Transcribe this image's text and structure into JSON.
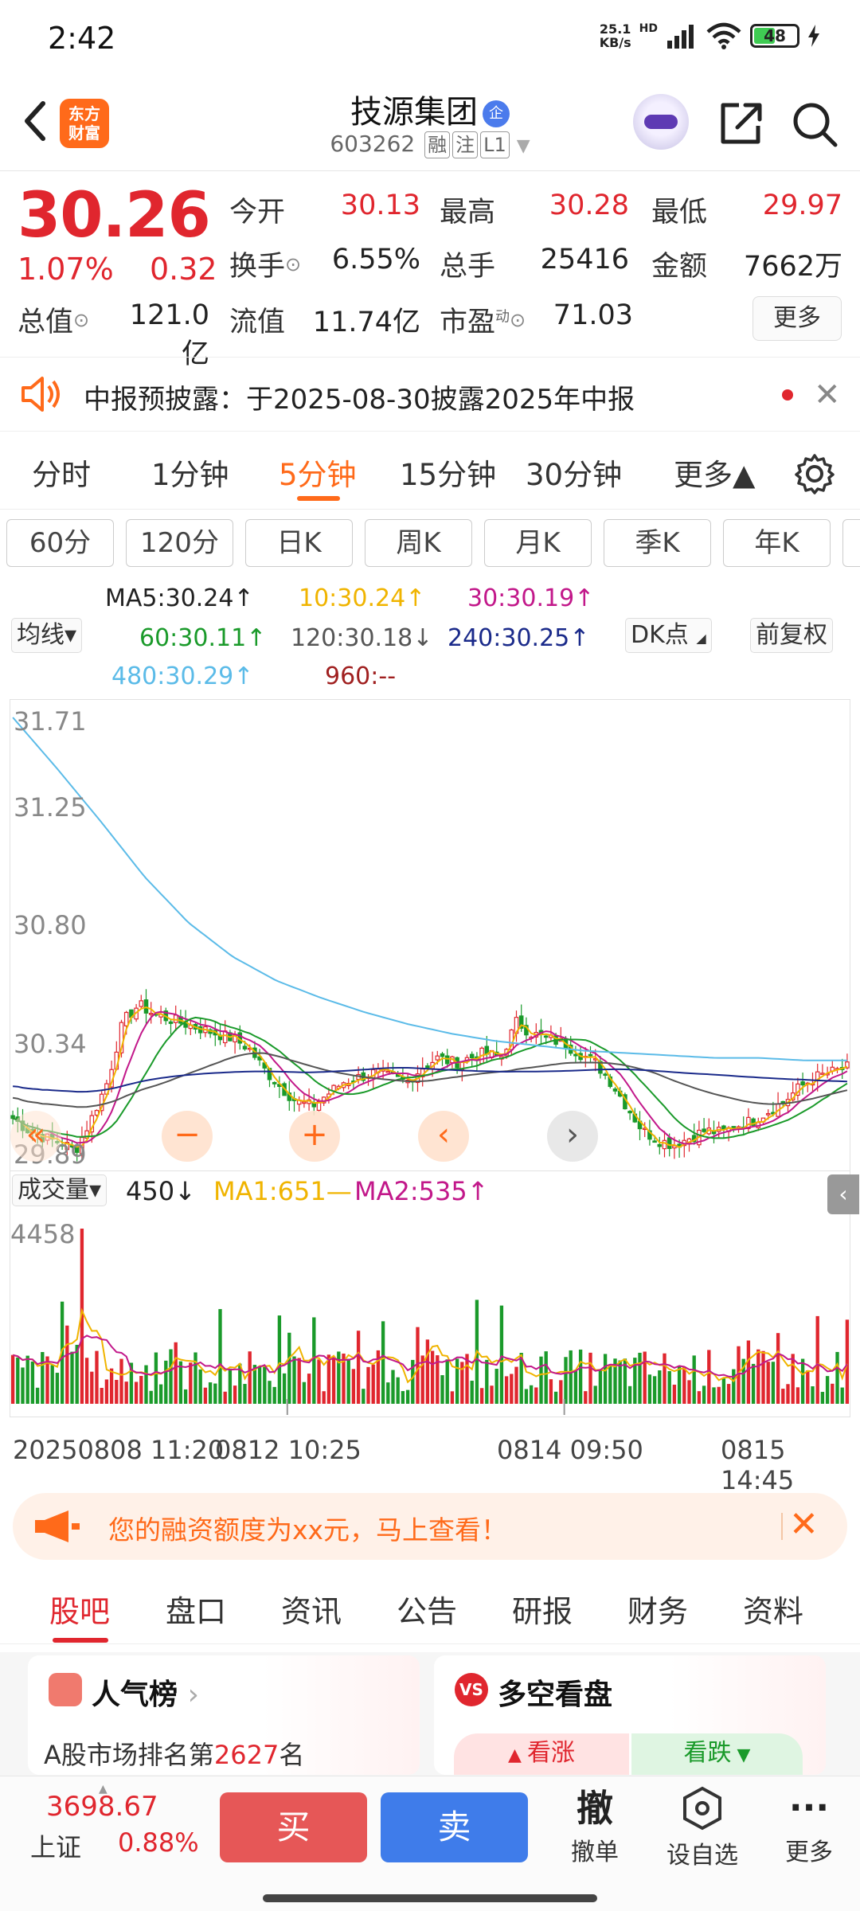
{
  "status_bar": {
    "time": "2:42",
    "net_speed_top": "25.1",
    "net_speed_bottom": "KB/s",
    "hd": "HD",
    "battery": "48"
  },
  "header": {
    "logo_line1": "东方",
    "logo_line2": "财富",
    "stock_name": "技源集团",
    "name_badge": "企",
    "stock_code": "603262",
    "tags": [
      "融",
      "注",
      "L1"
    ]
  },
  "quote": {
    "price": "30.26",
    "change_pct": "1.07%",
    "change": "0.32",
    "open_label": "今开",
    "open": "30.13",
    "high_label": "最高",
    "high": "30.28",
    "low_label": "最低",
    "low": "29.97",
    "turnover_label": "换手",
    "turnover": "6.55%",
    "volume_label": "总手",
    "volume": "25416",
    "amount_label": "金额",
    "amount": "7662万",
    "mktcap_label": "总值",
    "mktcap": "121.0亿",
    "float_label": "流值",
    "float_cap": "11.74亿",
    "pe_label": "市盈",
    "pe_sup": "动",
    "pe": "71.03",
    "more": "更多"
  },
  "notice": {
    "text": "中报预披露：于2025-08-30披露2025年中报"
  },
  "period_tabs": [
    "分时",
    "1分钟",
    "5分钟",
    "15分钟",
    "30分钟",
    "更多▲"
  ],
  "active_period": "5分钟",
  "kline_tabs": [
    "60分",
    "120分",
    "日K",
    "周K",
    "月K",
    "季K",
    "年K"
  ],
  "ma": {
    "selector": "均线▾",
    "ma5": "MA5:30.24↑",
    "ma10": "10:30.24↑",
    "ma30": "30:30.19↑",
    "ma60": "60:30.11↑",
    "ma120": "120:30.18↓",
    "ma240": "240:30.25↑",
    "ma480": "480:30.29↑",
    "ma960": "960:--",
    "dk": "DK点",
    "adjust": "前复权"
  },
  "colors": {
    "red": "#e0262e",
    "green": "#1a9a2a",
    "ma5": "#222222",
    "ma10": "#f0b400",
    "ma30": "#c2188a",
    "ma60": "#1a9a2a",
    "ma120": "#555555",
    "ma240": "#1a2a8a",
    "ma480": "#5bbbe8",
    "ma960": "#a02020",
    "accent": "#ff6a1a"
  },
  "chart_data": {
    "type": "candlestick",
    "y_ticks": [
      "31.71",
      "31.25",
      "30.80",
      "30.34",
      "29.89"
    ],
    "ylim": [
      29.89,
      31.71
    ],
    "x_labels": [
      "20250808 11:20",
      "0812 10:25",
      "0814 09:50",
      "0815 14:45"
    ],
    "close_path": [
      30.05,
      30.0,
      29.97,
      29.95,
      29.92,
      30.05,
      30.2,
      30.45,
      30.52,
      30.48,
      30.46,
      30.44,
      30.42,
      30.4,
      30.38,
      30.34,
      30.25,
      30.18,
      30.12,
      30.1,
      30.15,
      30.2,
      30.22,
      30.24,
      30.22,
      30.2,
      30.26,
      30.3,
      30.28,
      30.3,
      30.32,
      30.3,
      30.45,
      30.4,
      30.38,
      30.36,
      30.32,
      30.28,
      30.2,
      30.1,
      30.0,
      29.96,
      29.94,
      29.97,
      30.0,
      29.99,
      30.02,
      30.04,
      30.08,
      30.12,
      30.18,
      30.22,
      30.24,
      30.26
    ],
    "ma480_path": [
      31.71,
      31.5,
      31.28,
      31.05,
      30.86,
      30.72,
      30.62,
      30.55,
      30.49,
      30.44,
      30.4,
      30.37,
      30.35,
      30.33,
      30.32,
      30.31,
      30.3,
      30.3,
      30.29,
      30.29
    ]
  },
  "volume": {
    "selector": "成交量▾",
    "value": "450↓",
    "ma1": "MA1:651—",
    "ma2": "MA2:535↑",
    "y_tick": "4458"
  },
  "promo": {
    "text": "您的融资额度为xx元，马上查看！"
  },
  "info_tabs": [
    "股吧",
    "盘口",
    "资讯",
    "公告",
    "研报",
    "财务",
    "资料"
  ],
  "cards": {
    "popularity_title": "人气榜",
    "popularity_rank_prefix": "A股市场排名第",
    "popularity_rank": "2627",
    "popularity_rank_suffix": "名",
    "sentiment_title": "多空看盘",
    "bull": "看涨",
    "bear": "看跌"
  },
  "bottom": {
    "index_value": "3698.67",
    "index_name": "上证",
    "index_pct": "0.88%",
    "buy": "买",
    "sell": "卖",
    "cancel_big": "撤",
    "cancel": "撤单",
    "watchlist": "设自选",
    "more": "更多"
  }
}
